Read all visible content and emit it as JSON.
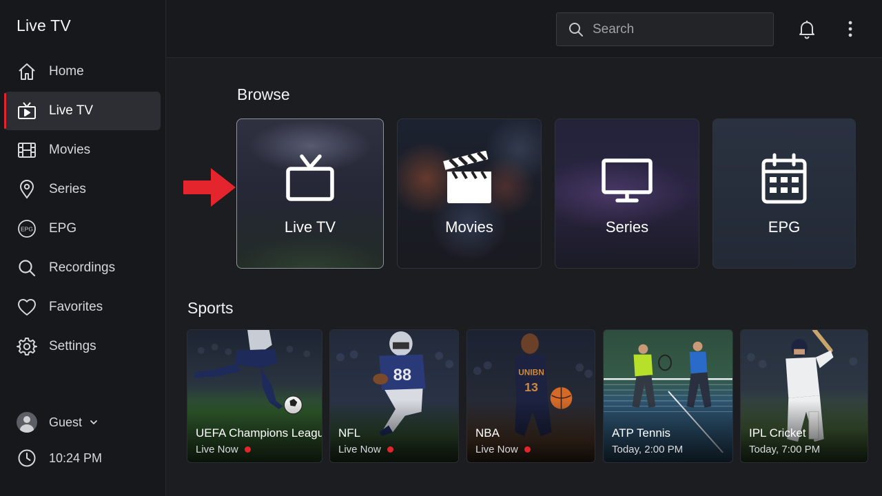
{
  "app": {
    "title": "Live TV"
  },
  "sidebar": {
    "items": [
      {
        "label": "Home",
        "icon": "home-icon"
      },
      {
        "label": "Live TV",
        "icon": "tv-icon",
        "active": true
      },
      {
        "label": "Movies",
        "icon": "film-icon"
      },
      {
        "label": "Series",
        "icon": "location-pin-icon"
      },
      {
        "label": "EPG",
        "icon": "epg-icon",
        "icon_text": "EPG"
      },
      {
        "label": "Recordings",
        "icon": "search-icon"
      },
      {
        "label": "Favorites",
        "icon": "heart-icon"
      },
      {
        "label": "Settings",
        "icon": "gear-icon"
      }
    ],
    "user": {
      "name": "Guest"
    },
    "time": "10:24 PM"
  },
  "header": {
    "search_placeholder": "Search"
  },
  "browse": {
    "title": "Browse",
    "cards": [
      {
        "label": "Live TV",
        "icon": "tv-icon",
        "selected": true
      },
      {
        "label": "Movies",
        "icon": "clapperboard-icon"
      },
      {
        "label": "Series",
        "icon": "monitor-icon"
      },
      {
        "label": "EPG",
        "icon": "calendar-icon"
      }
    ]
  },
  "sports": {
    "title": "Sports",
    "cards": [
      {
        "title": "UEFA Champions League",
        "status": "Live Now",
        "live": true
      },
      {
        "title": "NFL",
        "status": "Live Now",
        "live": true,
        "jersey_number": "88"
      },
      {
        "title": "NBA",
        "status": "Live Now",
        "live": true,
        "jersey_text": "UNIBN",
        "jersey_number": "13"
      },
      {
        "title": "ATP Tennis",
        "status": "Today, 2:00 PM",
        "live": false
      },
      {
        "title": "IPL Cricket",
        "status": "Today, 7:00 PM",
        "live": false
      }
    ]
  },
  "colors": {
    "accent": "#e5252d",
    "background": "#1b1d21",
    "sidebar": "#16181b"
  }
}
